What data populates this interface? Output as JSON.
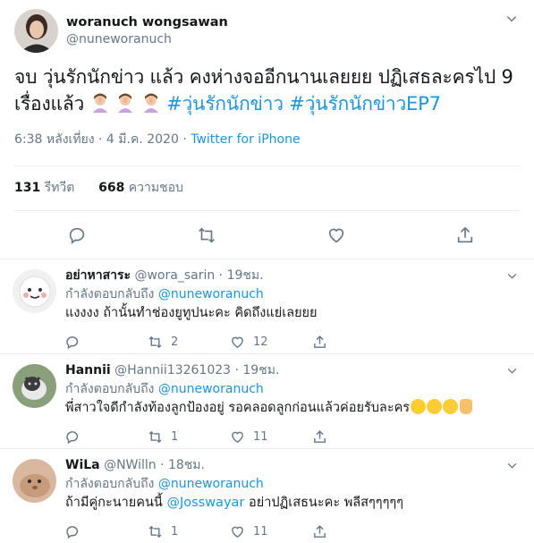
{
  "tweet": {
    "display_name": "woranuch wongsawan",
    "handle": "@nuneworanuch",
    "text": "จบ วุ่นรักนักข่าว แล้ว คงห่างจออีกนานเลยยย ปฏิเสธละครไป 9 เรื่องแล้ว",
    "hashtag1": "#วุ่นรักนักข่าว",
    "hashtag2": "#วุ่นรักนักข่าวEP7",
    "time": "6:38 หลังเที่ยง · 4 มี.ค. 2020 ·",
    "client": "Twitter for iPhone",
    "retweets_count": "131",
    "retweets_label": "รีทวีต",
    "likes_count": "668",
    "likes_label": "ความชอบ"
  },
  "replies": [
    {
      "name": "อย่าหาสาระ",
      "handle": "@wora_sarin",
      "time": "· 19ชม.",
      "replying_label": "กำลังตอบกลับถึง",
      "replying_to": "@nuneworanuch",
      "text": "แงงงง ถ้านั้นทำช่องยูทูปนะคะ คิดถึงแย่เลยยย",
      "retweets": "2",
      "likes": "12"
    },
    {
      "name": "Hannii",
      "handle": "@Hannii13261023",
      "time": "· 19ชม.",
      "replying_label": "กำลังตอบกลับถึง",
      "replying_to": "@nuneworanuch",
      "text": "พี่สาวใจดีกำลังท้องลูกป้องอยู่ รอคลอดลูกก่อนแล้วค่อยรับละคร",
      "retweets": "1",
      "likes": "11"
    },
    {
      "name": "WiLa",
      "handle": "@NWilln",
      "time": "· 18ชม.",
      "replying_label": "กำลังตอบกลับถึง",
      "replying_to": "@nuneworanuch",
      "text_before": "ถ้ามีคู่กะนายคนนี้",
      "mention": "@Josswayar",
      "text_after": "อย่าปฏิเสธนะคะ พลีสๆๆๆๆๆ",
      "retweets": "1",
      "likes": "11"
    }
  ],
  "icons": {
    "reply": "reply-icon",
    "retweet": "retweet-icon",
    "like": "heart-icon",
    "share": "share-icon",
    "more": "chevron-down-icon"
  },
  "colors": {
    "link": "#1b95e0",
    "secondary": "#657786",
    "divider": "#e6ecf0"
  }
}
